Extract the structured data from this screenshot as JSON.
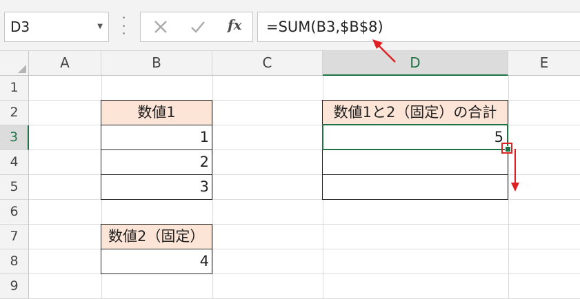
{
  "name_box": {
    "value": "D3"
  },
  "formula_bar": {
    "value": "=SUM(B3,$B$8)"
  },
  "icons": {
    "cancel": "close-icon",
    "enter": "check-icon",
    "function": "fx-icon",
    "fx_label": "fx"
  },
  "columns": [
    "A",
    "B",
    "C",
    "D",
    "E"
  ],
  "rows": [
    "1",
    "2",
    "3",
    "4",
    "5",
    "6",
    "7",
    "8",
    "9"
  ],
  "selected": {
    "column": "D",
    "row": "3"
  },
  "cells": {
    "b2": "数値1",
    "b3": "1",
    "b4": "2",
    "b5": "3",
    "b7": "数値2（固定）",
    "b8": "4",
    "d2": "数値1と2（固定）の合計",
    "d3": "5",
    "d4": "",
    "d5": ""
  },
  "colors": {
    "header_fill": "#fce4d6",
    "selection": "#217346",
    "annotation": "#e02020"
  }
}
